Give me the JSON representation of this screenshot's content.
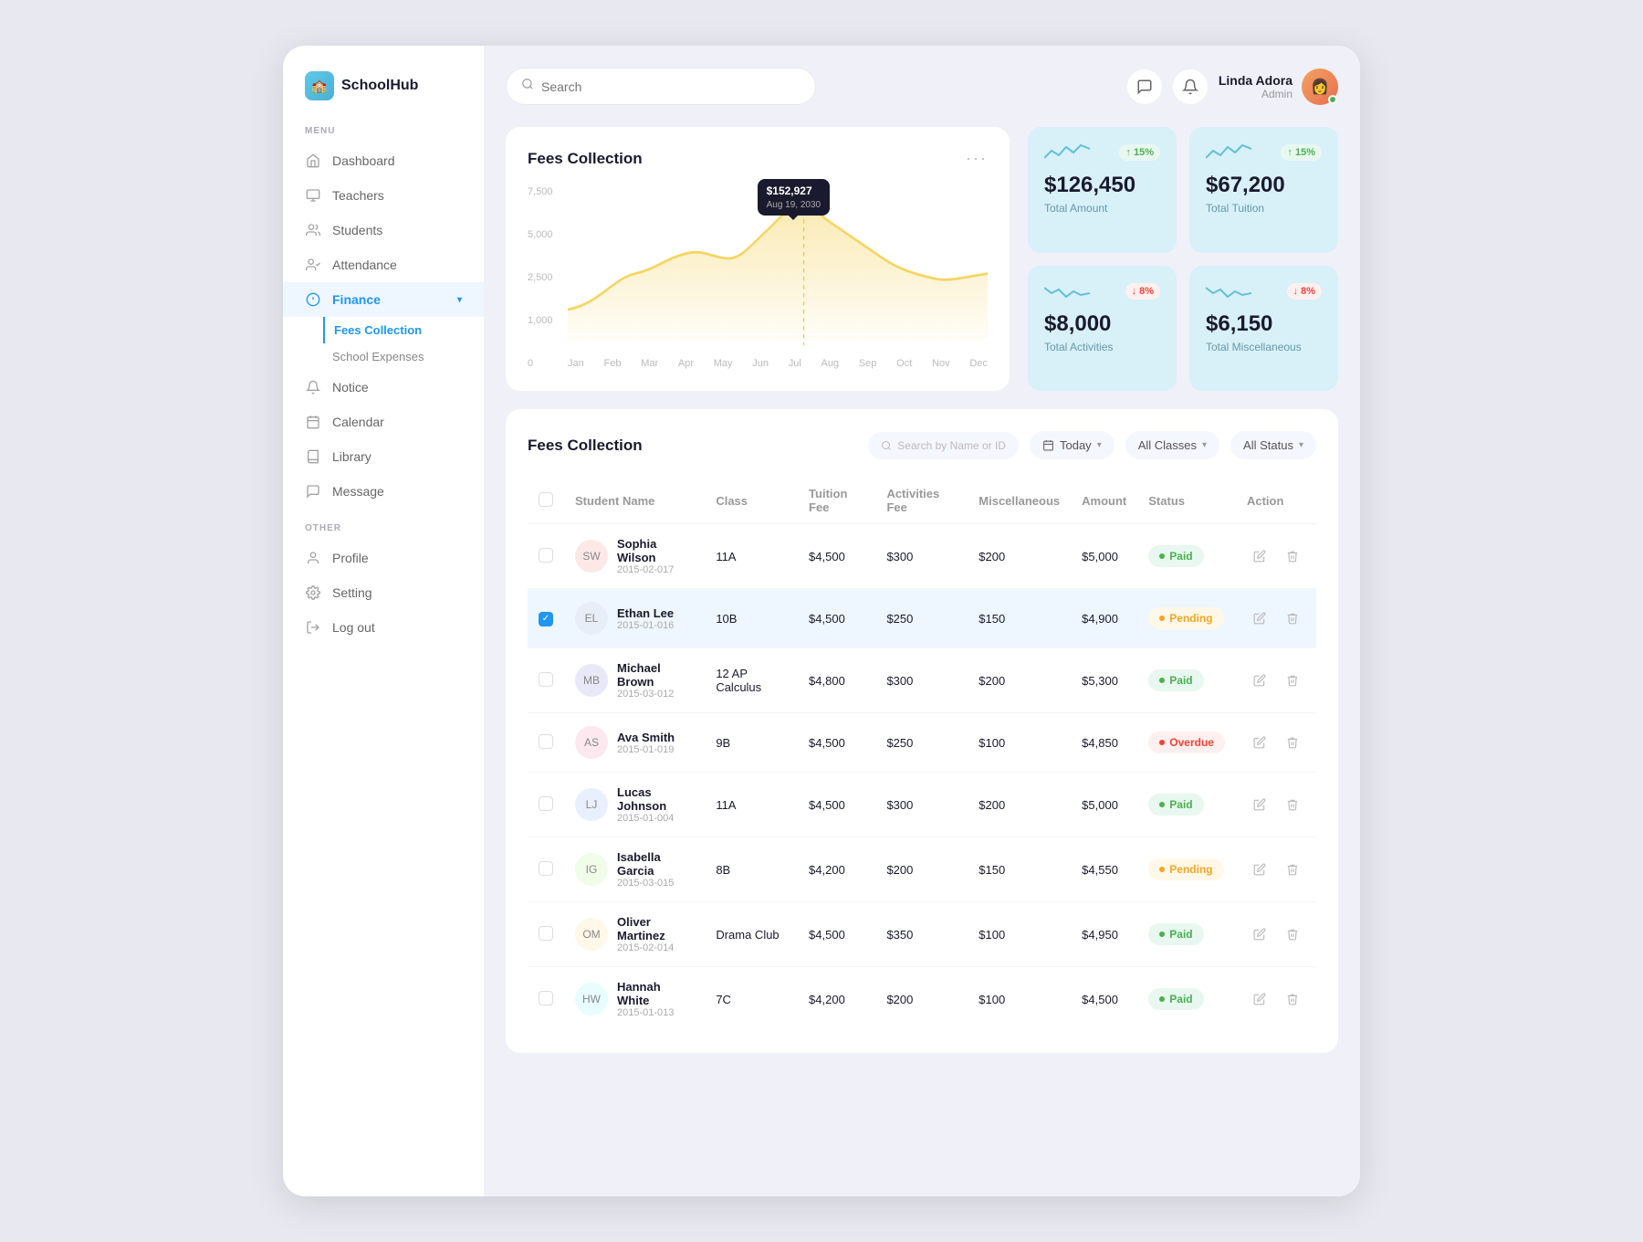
{
  "app": {
    "name": "SchoolHub"
  },
  "topbar": {
    "search_placeholder": "Search",
    "user": {
      "name": "Linda Adora",
      "role": "Admin"
    }
  },
  "sidebar": {
    "menu_label": "MENU",
    "other_label": "OTHER",
    "items": [
      {
        "id": "dashboard",
        "label": "Dashboard",
        "icon": "home"
      },
      {
        "id": "teachers",
        "label": "Teachers",
        "icon": "teacher"
      },
      {
        "id": "students",
        "label": "Students",
        "icon": "students"
      },
      {
        "id": "attendance",
        "label": "Attendance",
        "icon": "attendance"
      },
      {
        "id": "finance",
        "label": "Finance",
        "icon": "finance",
        "active": true,
        "expanded": true
      },
      {
        "id": "notice",
        "label": "Notice",
        "icon": "notice"
      },
      {
        "id": "calendar",
        "label": "Calendar",
        "icon": "calendar"
      },
      {
        "id": "library",
        "label": "Library",
        "icon": "library"
      },
      {
        "id": "message",
        "label": "Message",
        "icon": "message"
      }
    ],
    "finance_sub": [
      {
        "id": "fees-collection",
        "label": "Fees Collection",
        "active": true
      },
      {
        "id": "school-expenses",
        "label": "School Expenses"
      }
    ],
    "other_items": [
      {
        "id": "profile",
        "label": "Profile"
      },
      {
        "id": "setting",
        "label": "Setting"
      },
      {
        "id": "logout",
        "label": "Log out"
      }
    ]
  },
  "chart": {
    "title": "Fees Collection",
    "tooltip_amount": "$152,927",
    "tooltip_date": "Aug 19, 2030",
    "y_labels": [
      "7,500",
      "5,000",
      "2,500",
      "1,000",
      "0"
    ],
    "x_months": [
      "Jan",
      "Feb",
      "Mar",
      "Apr",
      "May",
      "Jun",
      "Jul",
      "Aug",
      "Sep",
      "Oct",
      "Nov",
      "Dec"
    ]
  },
  "stat_cards": [
    {
      "id": "total-amount",
      "amount": "$126,450",
      "label": "Total Amount",
      "badge": "+15%",
      "badge_type": "up",
      "bg": "#d8f0f8"
    },
    {
      "id": "total-tuition",
      "amount": "$67,200",
      "label": "Total Tuition",
      "badge": "+15%",
      "badge_type": "up",
      "bg": "#d8f0f8"
    },
    {
      "id": "total-activities",
      "amount": "$8,000",
      "label": "Total Activities",
      "badge": "-8%",
      "badge_type": "down",
      "bg": "#d8f0f8"
    },
    {
      "id": "total-miscellaneous",
      "amount": "$6,150",
      "label": "Total Miscellaneous",
      "badge": "-8%",
      "badge_type": "down",
      "bg": "#d8f0f8"
    }
  ],
  "fees_table": {
    "title": "Fees Collection",
    "search_placeholder": "Search by Name or ID",
    "filters": {
      "date": "Today",
      "class": "All Classes",
      "status": "All Status"
    },
    "columns": [
      "Student Name",
      "Class",
      "Tuition Fee",
      "Activities Fee",
      "Miscellaneous",
      "Amount",
      "Status",
      "Action"
    ],
    "rows": [
      {
        "id": "sophia-wilson",
        "name": "Sophia Wilson",
        "student_id": "2015-02-017",
        "class": "11A",
        "tuition": "$4,500",
        "activities": "$300",
        "misc": "$200",
        "amount": "$5,000",
        "status": "Paid",
        "status_type": "paid",
        "highlighted": false,
        "checked": false,
        "av_class": "av-sophia",
        "initials": "SW"
      },
      {
        "id": "ethan-lee",
        "name": "Ethan Lee",
        "student_id": "2015-01-016",
        "class": "10B",
        "tuition": "$4,500",
        "activities": "$250",
        "misc": "$150",
        "amount": "$4,900",
        "status": "Pending",
        "status_type": "pending",
        "highlighted": true,
        "checked": true,
        "av_class": "av-ethan",
        "initials": "EL"
      },
      {
        "id": "michael-brown",
        "name": "Michael Brown",
        "student_id": "2015-03-012",
        "class": "12 AP Calculus",
        "tuition": "$4,800",
        "activities": "$300",
        "misc": "$200",
        "amount": "$5,300",
        "status": "Paid",
        "status_type": "paid",
        "highlighted": false,
        "checked": false,
        "av_class": "av-michael",
        "initials": "MB"
      },
      {
        "id": "ava-smith",
        "name": "Ava Smith",
        "student_id": "2015-01-019",
        "class": "9B",
        "tuition": "$4,500",
        "activities": "$250",
        "misc": "$100",
        "amount": "$4,850",
        "status": "Overdue",
        "status_type": "overdue",
        "highlighted": false,
        "checked": false,
        "av_class": "av-ava",
        "initials": "AS"
      },
      {
        "id": "lucas-johnson",
        "name": "Lucas Johnson",
        "student_id": "2015-01-004",
        "class": "11A",
        "tuition": "$4,500",
        "activities": "$300",
        "misc": "$200",
        "amount": "$5,000",
        "status": "Paid",
        "status_type": "paid",
        "highlighted": false,
        "checked": false,
        "av_class": "av-lucas",
        "initials": "LJ"
      },
      {
        "id": "isabella-garcia",
        "name": "Isabella Garcia",
        "student_id": "2015-03-015",
        "class": "8B",
        "tuition": "$4,200",
        "activities": "$200",
        "misc": "$150",
        "amount": "$4,550",
        "status": "Pending",
        "status_type": "pending",
        "highlighted": false,
        "checked": false,
        "av_class": "av-isabella",
        "initials": "IG"
      },
      {
        "id": "oliver-martinez",
        "name": "Oliver Martinez",
        "student_id": "2015-02-014",
        "class": "Drama Club",
        "tuition": "$4,500",
        "activities": "$350",
        "misc": "$100",
        "amount": "$4,950",
        "status": "Paid",
        "status_type": "paid",
        "highlighted": false,
        "checked": false,
        "av_class": "av-oliver",
        "initials": "OM"
      },
      {
        "id": "hannah-white",
        "name": "Hannah White",
        "student_id": "2015-01-013",
        "class": "7C",
        "tuition": "$4,200",
        "activities": "$200",
        "misc": "$100",
        "amount": "$4,500",
        "status": "Paid",
        "status_type": "paid",
        "highlighted": false,
        "checked": false,
        "av_class": "av-hannah",
        "initials": "HW"
      }
    ]
  }
}
